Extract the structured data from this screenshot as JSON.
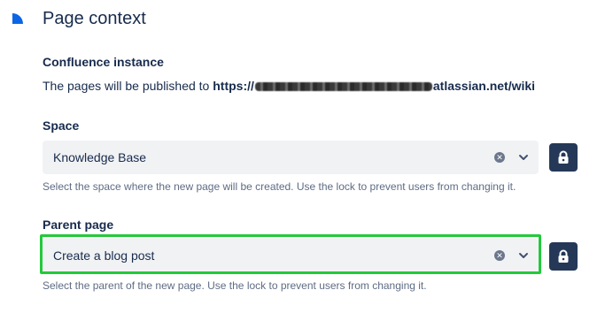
{
  "section": {
    "title": "Page context"
  },
  "instance": {
    "label": "Confluence instance",
    "text_prefix": "The pages will be published to ",
    "url_prefix": "https://",
    "url_suffix": "atlassian.net/wiki"
  },
  "space": {
    "label": "Space",
    "value": "Knowledge Base",
    "help": "Select the space where the new page will be created. Use the lock to prevent users from changing it."
  },
  "parent": {
    "label": "Parent page",
    "value": "Create a blog post",
    "help": "Select the parent of the new page. Use the lock to prevent users from changing it."
  },
  "icons": {
    "clear": "clear-icon",
    "dropdown": "chevron-down-icon",
    "lock": "lock-icon"
  },
  "colors": {
    "accent": "#0c66e4",
    "field_bg": "#f1f2f4",
    "lock_button": "#253858",
    "highlight": "#22c93a"
  }
}
